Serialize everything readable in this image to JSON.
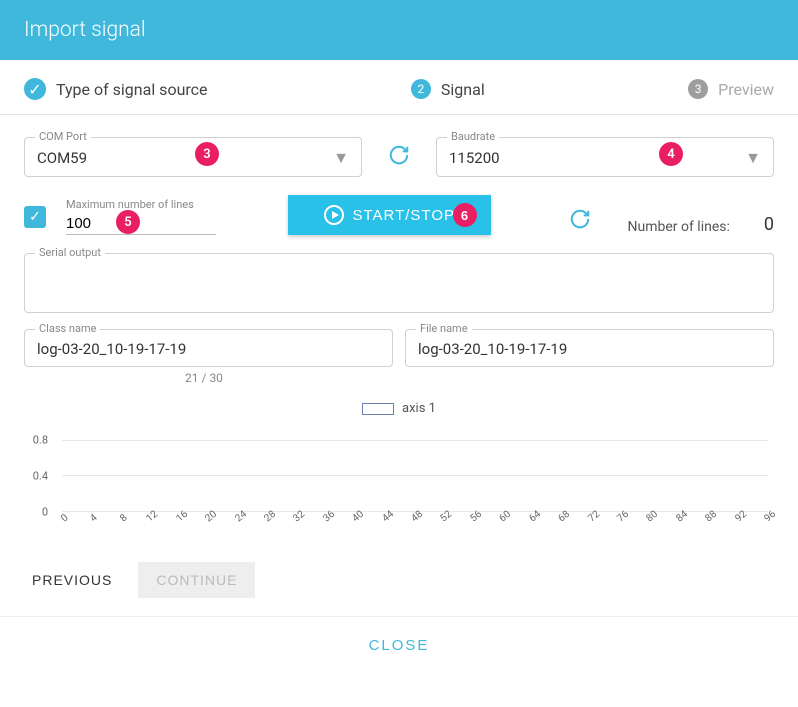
{
  "header": {
    "title": "Import signal"
  },
  "stepper": {
    "step1": {
      "label": "Type of signal source"
    },
    "step2": {
      "num": "2",
      "label": "Signal"
    },
    "step3": {
      "num": "3",
      "label": "Preview"
    }
  },
  "comport": {
    "label": "COM Port",
    "value": "COM59"
  },
  "baudrate": {
    "label": "Baudrate",
    "value": "115200"
  },
  "maxlines": {
    "label": "Maximum number of lines",
    "value": "100"
  },
  "startstop": {
    "label": "START/STOP"
  },
  "numlines": {
    "label": "Number of lines:",
    "value": "0"
  },
  "serial": {
    "label": "Serial output"
  },
  "classname": {
    "label": "Class name",
    "value": "log-03-20_10-19-17-19"
  },
  "filename": {
    "label": "File name",
    "value": "log-03-20_10-19-17-19"
  },
  "counter": "21 / 30",
  "badges": {
    "b3": "3",
    "b4": "4",
    "b5": "5",
    "b6": "6"
  },
  "chart_data": {
    "type": "line",
    "title": "",
    "legend": "axis 1",
    "xlabel": "",
    "ylabel": "",
    "x_ticks": [
      0,
      4,
      8,
      12,
      16,
      20,
      24,
      28,
      32,
      36,
      40,
      44,
      48,
      52,
      56,
      60,
      64,
      68,
      72,
      76,
      80,
      84,
      88,
      92,
      96
    ],
    "y_ticks": [
      0,
      0.4,
      0.8
    ],
    "ylim": [
      0,
      1
    ],
    "series": [
      {
        "name": "axis 1",
        "x": [],
        "y": []
      }
    ]
  },
  "footer": {
    "previous": "PREVIOUS",
    "continue": "CONTINUE",
    "close": "CLOSE"
  }
}
